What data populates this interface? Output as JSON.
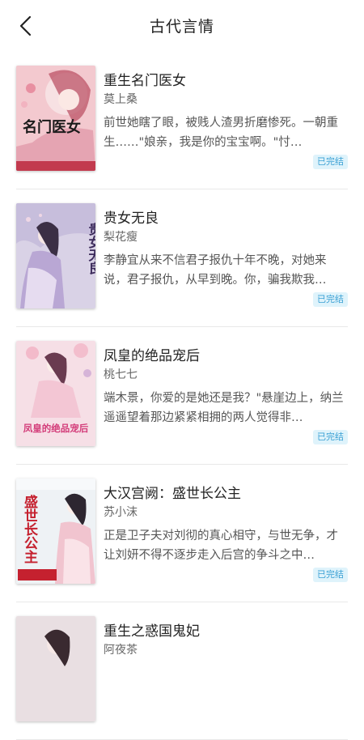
{
  "header": {
    "title": "古代言情"
  },
  "books": [
    {
      "title": "重生名门医女",
      "author": "莫上桑",
      "description": "前世她瞎了眼，被贱人渣男折磨惨死。一朝重生……\"娘亲，我是你的宝宝啊。\"忖…",
      "status": "已完结",
      "cover_text": "名门医女",
      "cover_color": "#f3c9cf"
    },
    {
      "title": "贵女无良",
      "author": "梨花瘦",
      "description": "李静宜从来不信君子报仇十年不晚，对她来说，君子报仇，从早到晚。你，骗我欺我…",
      "status": "已完结",
      "cover_text": "贵女无良",
      "cover_color": "#d9d2e6"
    },
    {
      "title": "凤皇的绝品宠后",
      "author": "桃七七",
      "description": "端木景，你爱的是她还是我？\"悬崖边上，纳兰遥遥望着那边紧紧相拥的两人觉得非…",
      "status": "已完结",
      "cover_text": "凤皇的绝品宠后",
      "cover_color": "#f6dfe6"
    },
    {
      "title": "大汉宫阙：盛世长公主",
      "author": "苏小沫",
      "description": "正是卫子夫对刘彻的真心相守，与世无争，才让刘妍不得不逐步走入后宫的争斗之中…",
      "status": "已完结",
      "cover_text": "盛世长公主",
      "cover_color": "#eef2f5"
    },
    {
      "title": "重生之惑国鬼妃",
      "author": "阿夜茶",
      "description": "",
      "status": "",
      "cover_text": "",
      "cover_color": "#e9dfe2"
    }
  ],
  "icons": {
    "back": "chevron-left-icon"
  },
  "colors": {
    "badge_text": "#3aa0d4",
    "badge_bg": "#dff3fb"
  }
}
